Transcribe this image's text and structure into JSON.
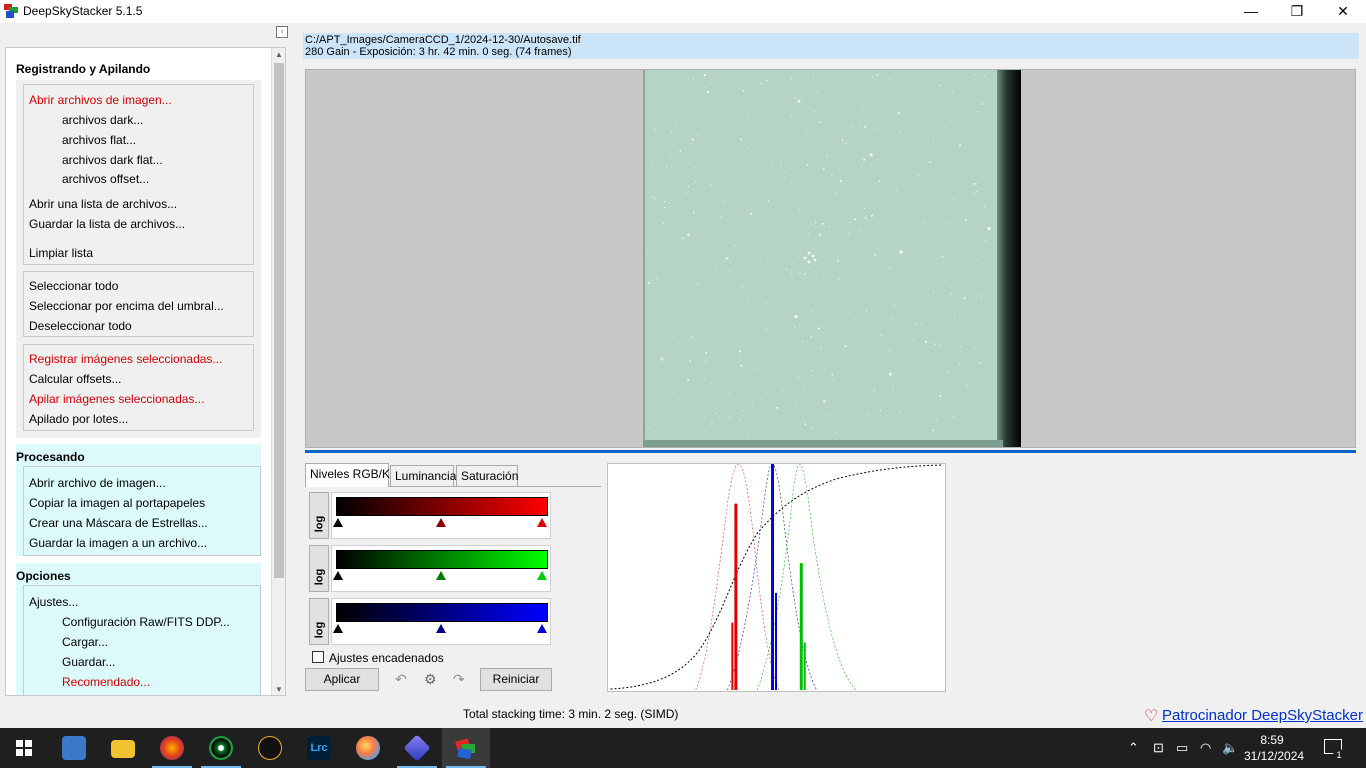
{
  "window": {
    "title": "DeepSkyStacker 5.1.5",
    "min": "—",
    "max": "❐",
    "close": "✕"
  },
  "panel": {
    "sec1": "Registrando y Apilando",
    "sec2": "Procesando",
    "sec3": "Opciones",
    "g1": [
      "Abrir archivos de imagen...",
      "archivos dark...",
      "archivos flat...",
      "archivos dark flat...",
      "archivos offset...",
      "Abrir una lista de archivos...",
      "Guardar la lista de archivos...",
      "Limpiar lista"
    ],
    "g2": [
      "Seleccionar todo",
      "Seleccionar por encima del umbral...",
      "Deseleccionar todo"
    ],
    "g3": [
      "Registrar imágenes seleccionadas...",
      "Calcular offsets...",
      "Apilar imágenes seleccionadas...",
      "Apilado por lotes..."
    ],
    "g4": [
      "Abrir archivo de imagen...",
      "Copiar la imagen al portapapeles",
      "Crear una Máscara de Estrellas...",
      "Guardar la imagen a un archivo..."
    ],
    "g5": [
      "Ajustes...",
      "Configuración Raw/FITS DDP...",
      "Cargar...",
      "Guardar...",
      "Recomendado..."
    ]
  },
  "file": {
    "path": "C:/APT_Images/CameraCCD_1/2024-12-30/Autosave.tif",
    "info": "280 Gain - Exposición: 3 hr. 42 min. 0 seg. (74 frames)"
  },
  "tabs": [
    "Niveles RGB/K",
    "Luminancia",
    "Saturación"
  ],
  "levels": {
    "log": "log",
    "chained": "Ajustes encadenados",
    "apply": "Aplicar",
    "reset": "Reiniciar"
  },
  "status": {
    "total": "Total stacking time: 3 min. 2 seg.  (SIMD)",
    "sponsor": "Patrocinador DeepSkyStacker"
  },
  "taskbar": {
    "apps": [
      "start-icon",
      "network-tool-icon",
      "file-explorer-icon",
      "firefox-icon",
      "sharpcap-icon",
      "astro-app-icon",
      "lightroom-icon",
      "paint-icon",
      "cube-app-icon",
      "deepskystacker-icon"
    ],
    "lrc": "Lrc",
    "time": "8:59",
    "date": "31/12/2024",
    "notifications": "1"
  },
  "colors": {
    "accent_red": "#d40000",
    "panel_tint": "#dcfafa",
    "header_blue": "#cce4f7",
    "selection_blue": "#0a64c8"
  }
}
